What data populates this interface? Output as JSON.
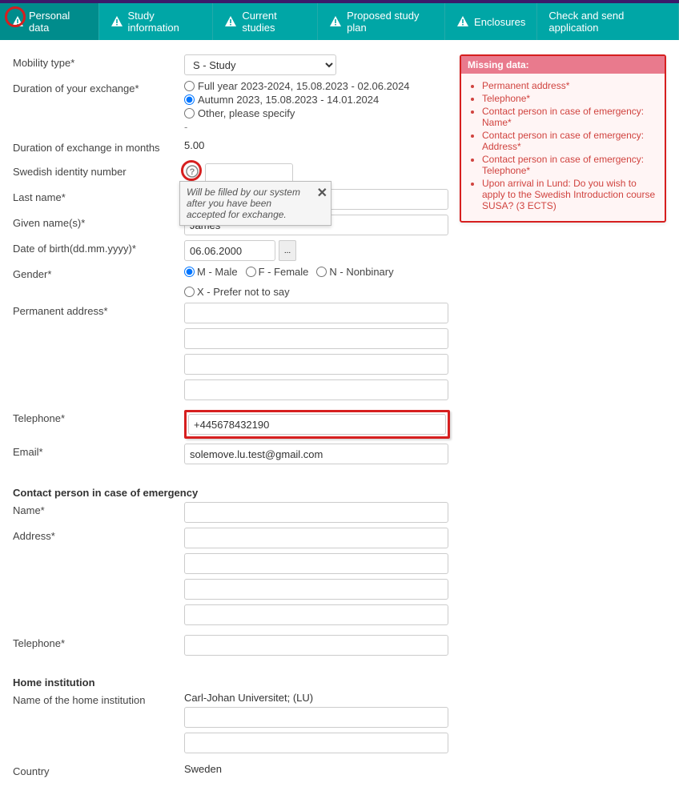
{
  "tabs": [
    {
      "label": "Personal data",
      "active": true,
      "warn": true
    },
    {
      "label": "Study information",
      "warn": true
    },
    {
      "label": "Current studies",
      "warn": true
    },
    {
      "label": "Proposed study plan",
      "warn": true
    },
    {
      "label": "Enclosures",
      "warn": true
    },
    {
      "label": "Check and send application",
      "warn": false
    }
  ],
  "labels": {
    "mobility": "Mobility type*",
    "duration_exchange": "Duration of your exchange*",
    "duration_months": "Duration of exchange in months",
    "sin": "Swedish identity number",
    "last_name": "Last name*",
    "given_names": "Given name(s)*",
    "dob": "Date of birth(dd.mm.yyyy)*",
    "gender": "Gender*",
    "perm_addr": "Permanent address*",
    "telephone": "Telephone*",
    "email": "Email*",
    "emerg_head": "Contact person in case of emergency",
    "emerg_name": "Name*",
    "emerg_addr": "Address*",
    "emerg_tel": "Telephone*",
    "home_head": "Home institution",
    "home_name": "Name of the home institution",
    "country": "Country"
  },
  "mobility_select": "S - Study",
  "exchange_options": {
    "full": "Full year 2023-2024, 15.08.2023 - 02.06.2024",
    "autumn": "Autumn 2023, 15.08.2023 - 14.01.2024",
    "other": "Other, please specify"
  },
  "duration_months": "5.00",
  "tooltip_text": "Will be filled by our system after you have been accepted for exchange.",
  "given_names": "James",
  "dob": "06.06.2000",
  "gender_opts": {
    "m": "M - Male",
    "f": "F - Female",
    "n": "N - Nonbinary",
    "x": "X - Prefer not to say"
  },
  "telephone": "+445678432190",
  "email": "solemove.lu.test@gmail.com",
  "home_institution": "Carl-Johan Universitet; (LU)",
  "country_value": "Sweden",
  "missing": {
    "title": "Missing data:",
    "items": [
      "Permanent address*",
      "Telephone*",
      "Contact person in case of emergency: Name*",
      "Contact person in case of emergency: Address*",
      "Contact person in case of emergency: Telephone*",
      "Upon arrival in Lund: Do you wish to apply to the Swedish Introduction course SUSA? (3 ECTS)"
    ]
  }
}
